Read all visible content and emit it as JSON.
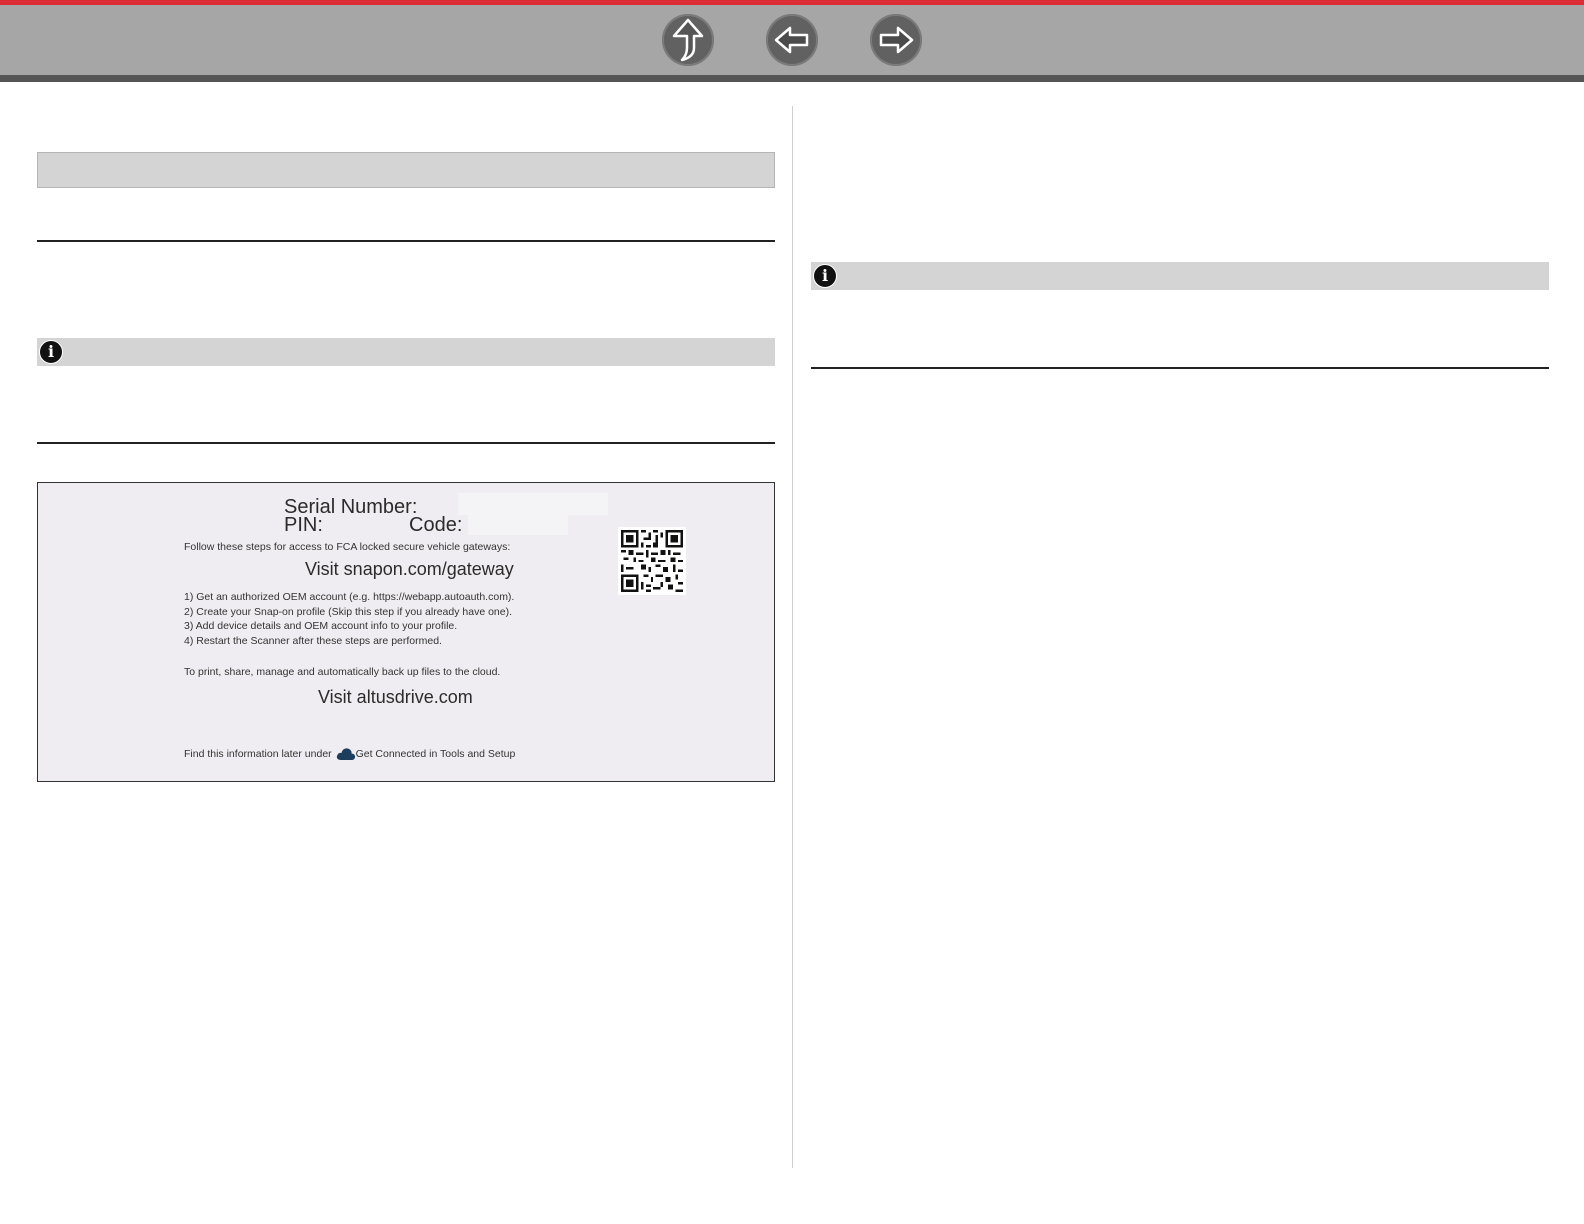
{
  "topbar": {
    "accent_color": "#dc2d37",
    "bar_color": "#a6a6a6",
    "buttons": [
      {
        "id": "up",
        "icon": "up-arrow-icon"
      },
      {
        "id": "back",
        "icon": "left-arrow-icon"
      },
      {
        "id": "forward",
        "icon": "right-arrow-icon"
      }
    ]
  },
  "left_note": {
    "icon": "info-icon",
    "glyph": "i"
  },
  "right_note": {
    "icon": "info-icon",
    "glyph": "i"
  },
  "figure": {
    "serial_label": "Serial Number:",
    "pin_label": "PIN:",
    "code_label": "Code:",
    "steps_intro": "Follow these steps for access to FCA locked secure vehicle gateways:",
    "visit_gateway": "Visit snapon.com/gateway",
    "steps": [
      "1) Get an authorized OEM account (e.g. https://webapp.autoauth.com).",
      "2) Create your Snap-on profile (Skip this step if you already have one).",
      "3) Add device details and OEM account info to your profile.",
      "4) Restart the Scanner after these steps are performed."
    ],
    "cloud_intro": "To print, share, manage and automatically back up files to the cloud.",
    "visit_altus": "Visit  altusdrive.com",
    "footer_before": "Find this information later under ",
    "footer_icon": "cloud-icon",
    "footer_after": "Get Connected in Tools and Setup",
    "qr_icon": "qr-code-icon"
  }
}
